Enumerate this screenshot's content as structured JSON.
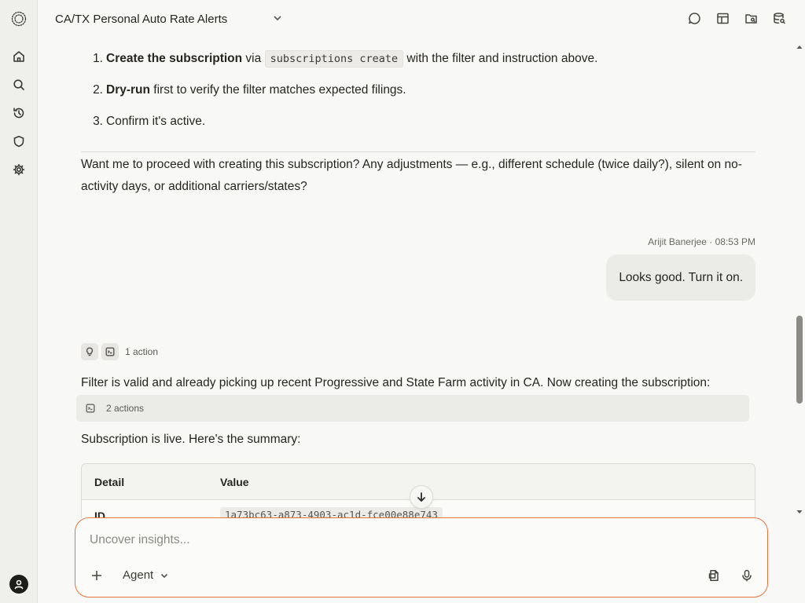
{
  "header": {
    "title": "CA/TX Personal Auto Rate Alerts",
    "icons": [
      "chat-icon",
      "layout-icon",
      "folder-search-icon",
      "database-search-icon"
    ]
  },
  "sidebar": {
    "icons": [
      "logo-icon",
      "home-icon",
      "search-icon",
      "history-icon",
      "shield-icon",
      "settings-icon",
      "user-avatar-icon"
    ]
  },
  "steps": [
    {
      "num": "1.",
      "bold": "Create the subscription",
      "pre": " via ",
      "code": "subscriptions create",
      "post": " with the filter and instruction above."
    },
    {
      "num": "2.",
      "bold": "Dry-run",
      "post": " first to verify the filter matches expected filings."
    },
    {
      "num": "3.",
      "post": "Confirm it's active."
    }
  ],
  "assistant_question": "Want me to proceed with creating this subscription? Any adjustments — e.g., different schedule (twice daily?), silent on no-activity days, or additional carriers/states?",
  "user_message": {
    "author": "Arijit Banerjee",
    "time": "08:53 PM",
    "text": "Looks good. Turn it on."
  },
  "reply": {
    "actions_label": "1 action",
    "filter_text": "Filter is valid and already picking up recent Progressive and State Farm activity in CA. Now creating the subscription:",
    "actions_bar_label": "2 actions",
    "summary_text": "Subscription is live. Here's the summary:",
    "table": {
      "headers": [
        "Detail",
        "Value"
      ],
      "rows": [
        [
          "ID",
          "1a73bc63-a873-4903-ac1d-fce00e88e743"
        ]
      ]
    }
  },
  "composer": {
    "placeholder": "Uncover insights...",
    "mode": "Agent"
  },
  "colors": {
    "accent": "#e8743b",
    "background": "#f8f8f6",
    "sidebar": "#efefec"
  }
}
